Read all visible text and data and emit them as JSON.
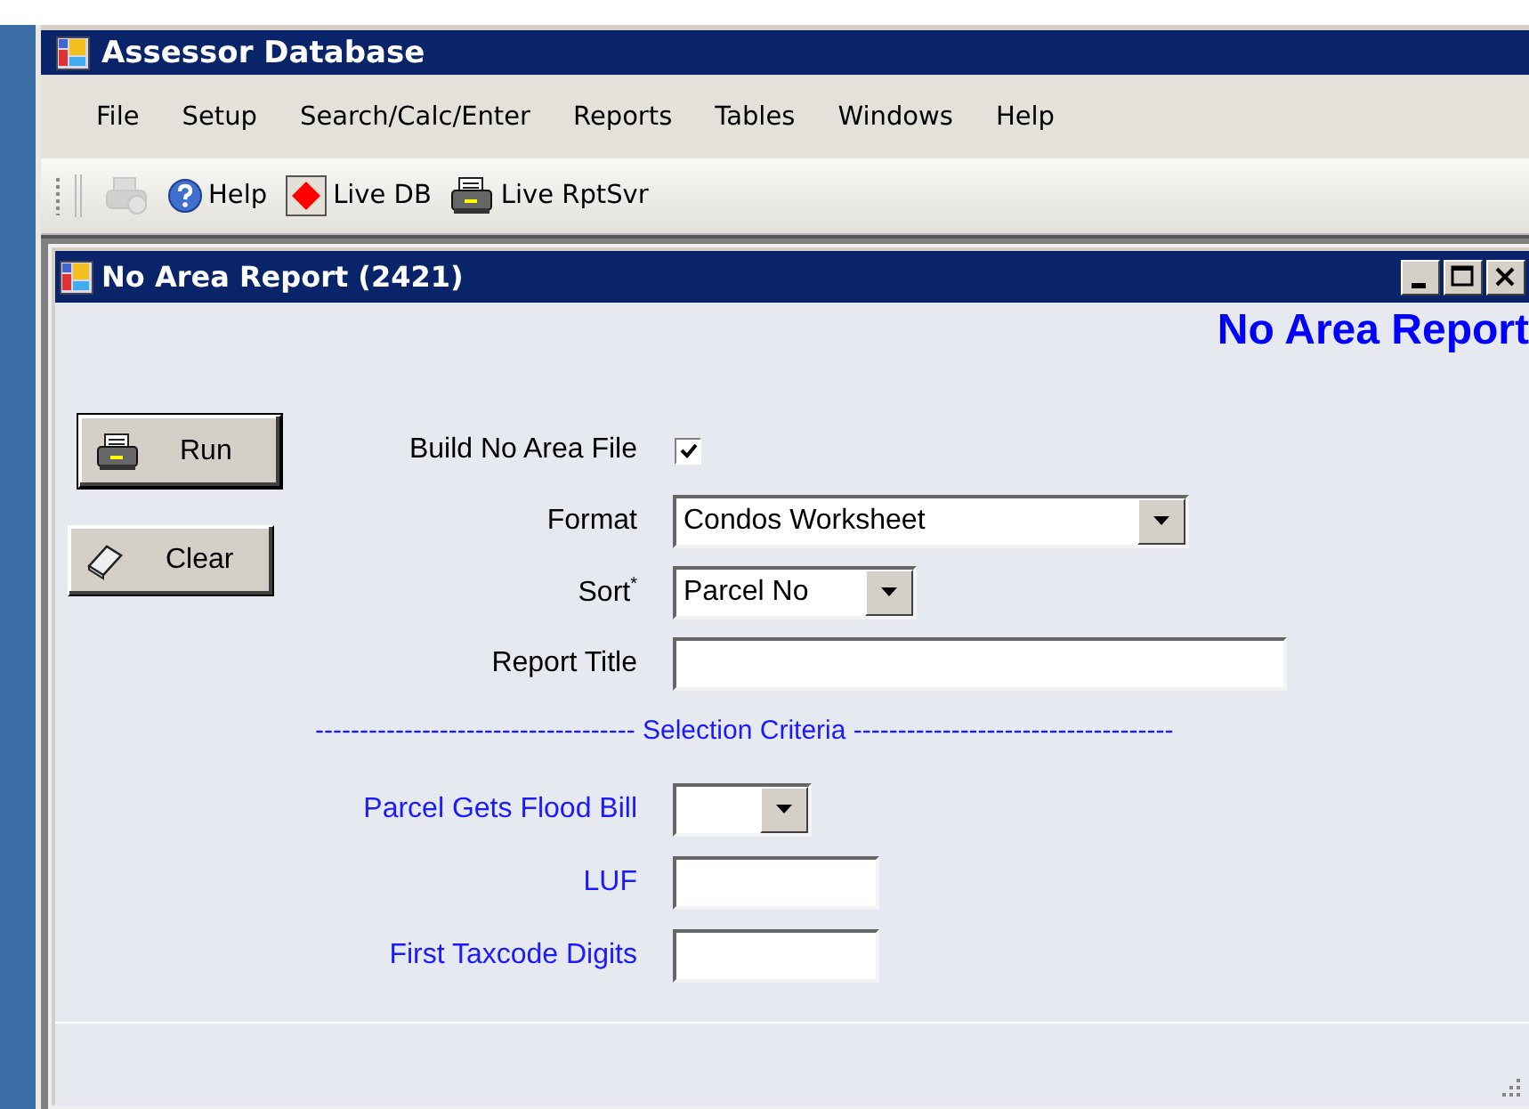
{
  "app": {
    "title": "Assessor Database"
  },
  "menu": [
    "File",
    "Setup",
    "Search/Calc/Enter",
    "Reports",
    "Tables",
    "Windows",
    "Help"
  ],
  "toolbar": [
    {
      "kind": "report",
      "disabled": true
    },
    {
      "kind": "help",
      "label": "Help",
      "disabled": false
    },
    {
      "kind": "live-db",
      "label": "Live DB",
      "disabled": false
    },
    {
      "kind": "print",
      "label": "Live RptSvr",
      "disabled": false
    }
  ],
  "report_window": {
    "title": "No Area Report (2421)",
    "heading": "No Area Report",
    "buttons": [
      {
        "kind": "print",
        "label": "Run"
      },
      {
        "kind": "erase",
        "label": "Clear"
      }
    ],
    "fields": [
      {
        "kind": "checkbox",
        "label": "Build No Area File",
        "checked": true
      },
      {
        "kind": "dropdown",
        "label": "Format",
        "value": "Condos Worksheet"
      },
      {
        "kind": "dropdown",
        "label": "Sort$^{*}$",
        "value": "Parcel No"
      },
      {
        "kind": "text",
        "label": "Report Title"
      }
    ],
    "criteria_header": "------------------------------------ Selection Criteria ------------------------------------",
    "criteria": [
      {
        "kind": "dropdown",
        "label": "Parcel Gets Flood Bill"
      },
      {
        "kind": "text",
        "label": "LUF"
      },
      {
        "kind": "text",
        "label": "First Taxcode Digits"
      }
    ]
  }
}
